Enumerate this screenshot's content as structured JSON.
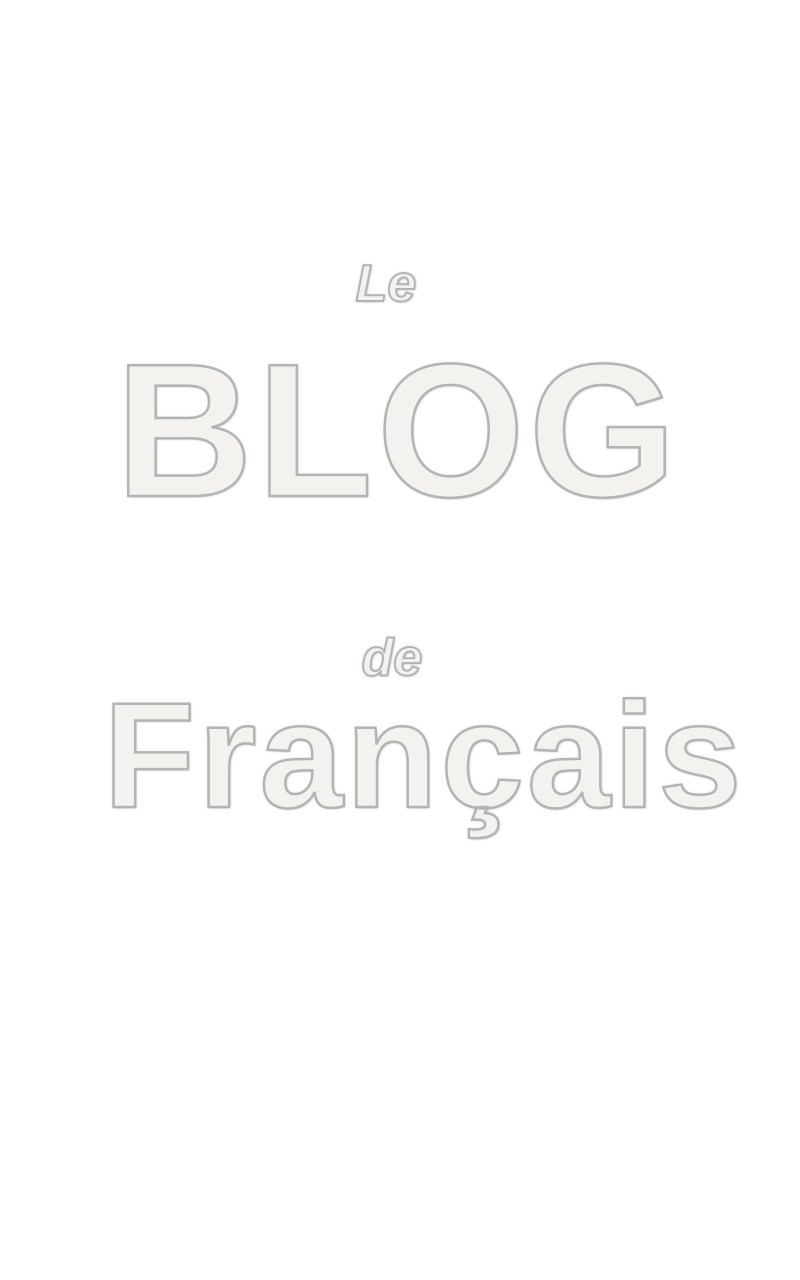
{
  "title": {
    "line1": "Le",
    "line2": "BLOG",
    "line3": "de",
    "line4": "Français"
  },
  "colors": {
    "background": "#ffffff",
    "letter_fill": "#f4f2ee",
    "letter_outline": "#b4b4b4"
  }
}
